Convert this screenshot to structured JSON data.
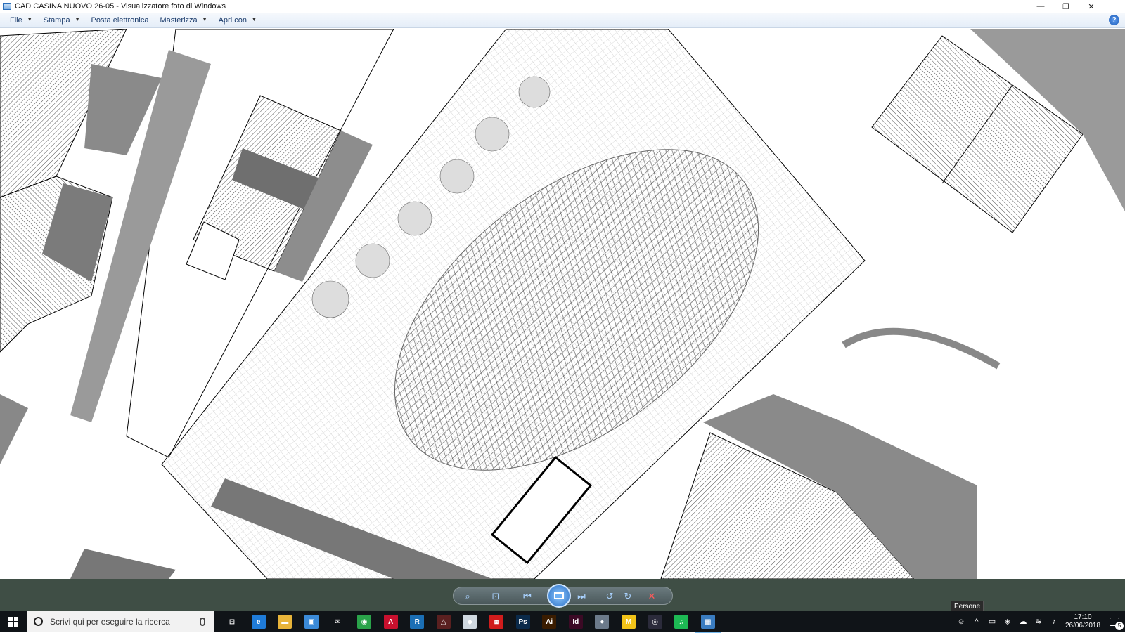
{
  "window": {
    "title": "CAD CASINA NUOVO 26-05 - Visualizzatore foto di Windows",
    "controls": {
      "minimize": "—",
      "restore": "❐",
      "close": "✕"
    }
  },
  "menubar": {
    "items": [
      {
        "label": "File",
        "has_dropdown": true
      },
      {
        "label": "Stampa",
        "has_dropdown": true
      },
      {
        "label": "Posta elettronica",
        "has_dropdown": false
      },
      {
        "label": "Masterizza",
        "has_dropdown": true
      },
      {
        "label": "Apri con",
        "has_dropdown": true
      }
    ],
    "caret": "▼",
    "help_label": "?"
  },
  "controls": {
    "zoom_icon": "magnifier-icon",
    "fit_icon": "actual-size-icon",
    "previous_icon": "previous-icon",
    "slideshow_icon": "slideshow-icon",
    "next_icon": "next-icon",
    "rotate_left_icon": "rotate-ccw-icon",
    "rotate_right_icon": "rotate-cw-icon",
    "delete_icon": "delete-icon"
  },
  "tooltip": {
    "text": "Persone"
  },
  "taskbar": {
    "search_placeholder": "Scrivi qui per eseguire la ricerca",
    "apps": [
      {
        "name": "task-view",
        "glyph": "⊟",
        "color": "#101418"
      },
      {
        "name": "edge",
        "glyph": "e",
        "color": "#1f7bd8"
      },
      {
        "name": "file-explorer",
        "glyph": "▬",
        "color": "#e8b43a"
      },
      {
        "name": "store",
        "glyph": "▣",
        "color": "#3b8ad8"
      },
      {
        "name": "mail",
        "glyph": "✉",
        "color": "#101418"
      },
      {
        "name": "chrome",
        "glyph": "◉",
        "color": "#2aa34a"
      },
      {
        "name": "autocad",
        "glyph": "A",
        "color": "#c8102e"
      },
      {
        "name": "revit",
        "glyph": "R",
        "color": "#1b6fb5"
      },
      {
        "name": "archicad",
        "glyph": "△",
        "color": "#5a2020"
      },
      {
        "name": "sketchup",
        "glyph": "◆",
        "color": "#cfd8e0"
      },
      {
        "name": "acrobat",
        "glyph": "⧈",
        "color": "#d01c1c"
      },
      {
        "name": "photoshop",
        "glyph": "Ps",
        "color": "#0b2a4a"
      },
      {
        "name": "illustrator",
        "glyph": "Ai",
        "color": "#3a1c00"
      },
      {
        "name": "indesign",
        "glyph": "Id",
        "color": "#3b0a25"
      },
      {
        "name": "app-sphere",
        "glyph": "●",
        "color": "#6c7a8a"
      },
      {
        "name": "app-m",
        "glyph": "M",
        "color": "#f2c318"
      },
      {
        "name": "obs",
        "glyph": "◎",
        "color": "#2b2b3b"
      },
      {
        "name": "spotify",
        "glyph": "♫",
        "color": "#1db954"
      },
      {
        "name": "photo-viewer",
        "glyph": "▦",
        "color": "#3a7cc0"
      }
    ],
    "tray": {
      "people_icon": "people-icon",
      "chevron": "^",
      "time": "17:10",
      "date": "26/06/2018",
      "notification_count": "5"
    }
  }
}
